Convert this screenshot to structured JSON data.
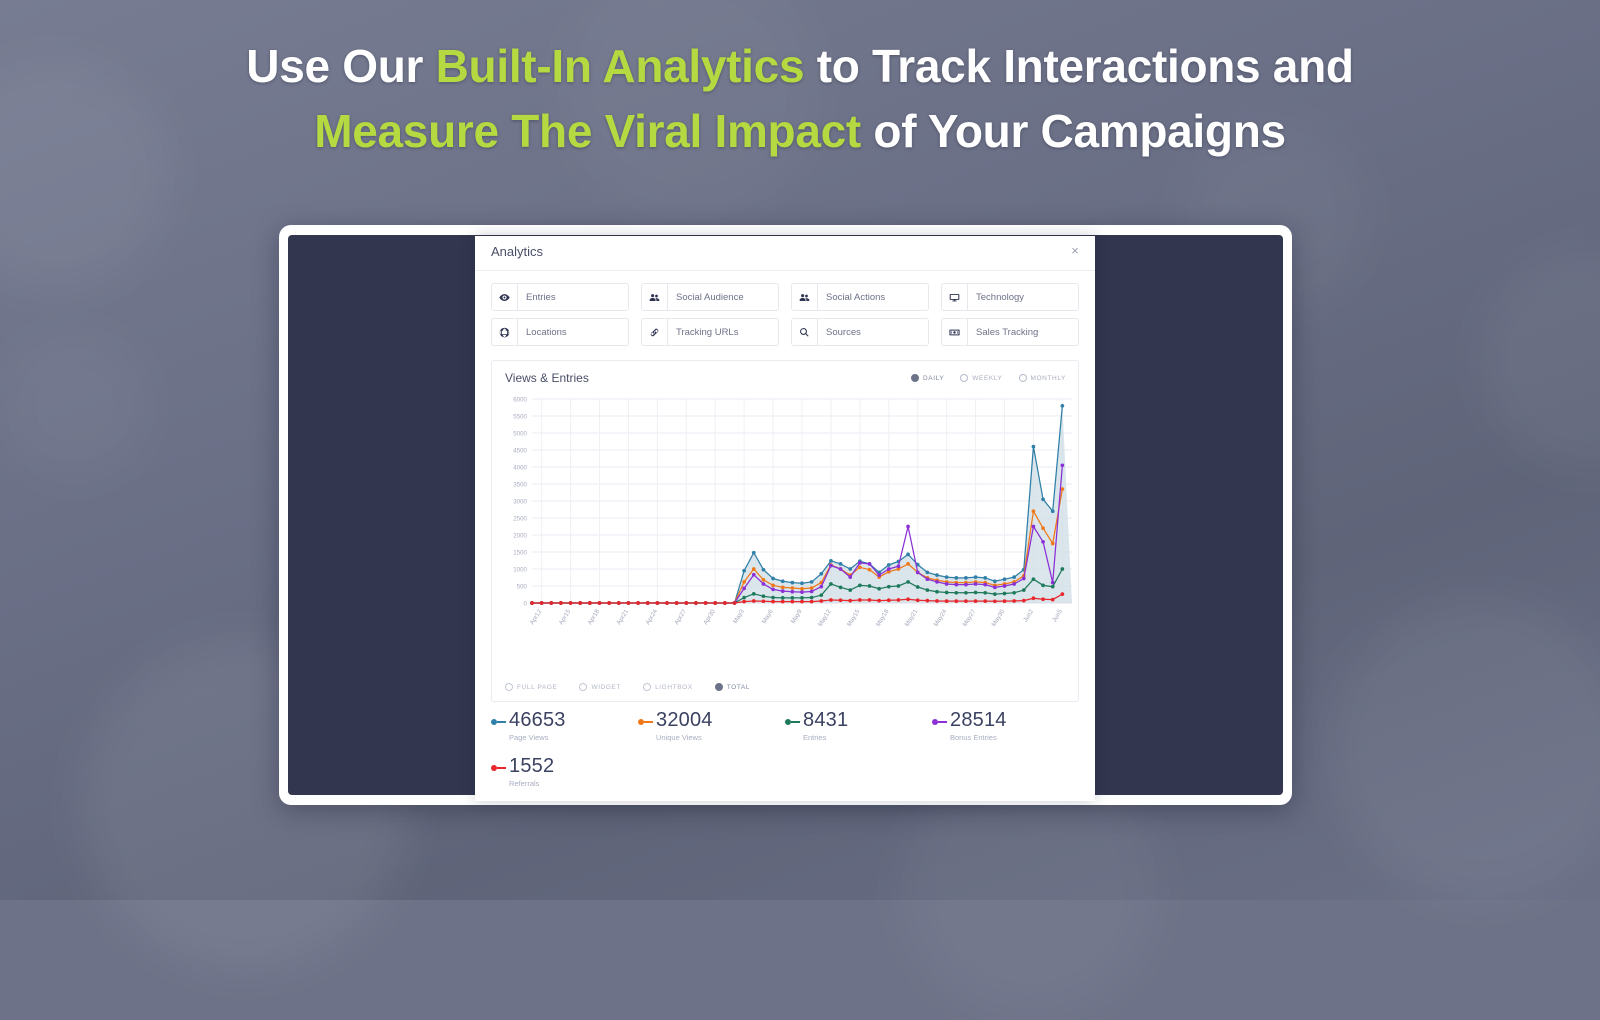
{
  "headline": {
    "line1_a": "Use Our ",
    "line1_hl": "Built-In Analytics",
    "line1_b": " to Track Interactions and",
    "line2_hl": "Measure The Viral Impact",
    "line2_b": " of Your Campaigns",
    "highlight_color": "#b5d940"
  },
  "modal": {
    "title": "Analytics",
    "close_label": "×"
  },
  "nav_buttons": [
    {
      "label": "Entries",
      "icon": "eye-icon"
    },
    {
      "label": "Social Audience",
      "icon": "people-icon"
    },
    {
      "label": "Social Actions",
      "icon": "people-icon"
    },
    {
      "label": "Technology",
      "icon": "monitor-icon"
    },
    {
      "label": "Locations",
      "icon": "globe-icon"
    },
    {
      "label": "Tracking URLs",
      "icon": "link-icon"
    },
    {
      "label": "Sources",
      "icon": "search-icon"
    },
    {
      "label": "Sales Tracking",
      "icon": "money-icon"
    }
  ],
  "chart_card": {
    "title": "Views & Entries",
    "granularity": [
      {
        "label": "DAILY",
        "selected": true
      },
      {
        "label": "WEEKLY",
        "selected": false
      },
      {
        "label": "MONTHLY",
        "selected": false
      }
    ],
    "view_types": [
      {
        "label": "FULL PAGE",
        "selected": false
      },
      {
        "label": "WIDGET",
        "selected": false
      },
      {
        "label": "LIGHTBOX",
        "selected": false
      },
      {
        "label": "TOTAL",
        "selected": true
      }
    ]
  },
  "stats": [
    {
      "value": "46653",
      "label": "Page Views",
      "color": "#2f7fa8"
    },
    {
      "value": "32004",
      "label": "Unique Views",
      "color": "#f07818"
    },
    {
      "value": "8431",
      "label": "Entries",
      "color": "#1f7a5c"
    },
    {
      "value": "28514",
      "label": "Bonus Entries",
      "color": "#8b2fd6"
    },
    {
      "value": "1552",
      "label": "Referrals",
      "color": "#e8262b"
    }
  ],
  "chart_data": {
    "type": "line",
    "title": "Views & Entries",
    "xlabel": "",
    "ylabel": "",
    "ylim": [
      0,
      6000
    ],
    "ytick_step": 500,
    "yticks": [
      0,
      500,
      1000,
      1500,
      2000,
      2500,
      3000,
      3500,
      4000,
      4500,
      5000,
      5500,
      6000
    ],
    "grid": true,
    "legend_position": "bottom",
    "area_fill": true,
    "x": [
      "Apr11",
      "Apr12",
      "Apr13",
      "Apr14",
      "Apr15",
      "Apr16",
      "Apr17",
      "Apr18",
      "Apr19",
      "Apr20",
      "Apr21",
      "Apr22",
      "Apr23",
      "Apr24",
      "Apr25",
      "Apr26",
      "Apr27",
      "Apr28",
      "Apr29",
      "Apr30",
      "May1",
      "May2",
      "May3",
      "May4",
      "May5",
      "May6",
      "May7",
      "May8",
      "May9",
      "May10",
      "May11",
      "May12",
      "May13",
      "May14",
      "May15",
      "May16",
      "May17",
      "May18",
      "May19",
      "May20",
      "May21",
      "May22",
      "May23",
      "May24",
      "May25",
      "May26",
      "May27",
      "May28",
      "May29",
      "May30",
      "May31",
      "Jun1",
      "Jun2",
      "Jun3",
      "Jun4",
      "Jun5",
      "Jun6"
    ],
    "xtick_labels": [
      "Apr12",
      "Apr15",
      "Apr18",
      "Apr21",
      "Apr24",
      "Apr27",
      "Apr30",
      "May3",
      "May6",
      "May9",
      "May12",
      "May15",
      "May18",
      "May21",
      "May24",
      "May27",
      "May30",
      "Jun2",
      "Jun5"
    ],
    "xtick_indices": [
      1,
      4,
      7,
      10,
      13,
      16,
      19,
      22,
      25,
      28,
      31,
      34,
      37,
      40,
      43,
      46,
      49,
      52,
      55
    ],
    "series": [
      {
        "name": "Page Views",
        "color": "#2f7fa8",
        "total": 46653,
        "values": [
          0,
          0,
          0,
          0,
          0,
          0,
          0,
          0,
          0,
          0,
          0,
          0,
          0,
          0,
          0,
          0,
          0,
          0,
          0,
          0,
          0,
          0,
          950,
          1480,
          980,
          720,
          640,
          600,
          580,
          620,
          860,
          1240,
          1150,
          1000,
          1230,
          1150,
          900,
          1120,
          1220,
          1430,
          1130,
          900,
          820,
          760,
          740,
          740,
          760,
          740,
          640,
          700,
          760,
          980,
          4600,
          3050,
          2700,
          5800
        ]
      },
      {
        "name": "Unique Views",
        "color": "#f07818",
        "total": 32004,
        "values": [
          0,
          0,
          0,
          0,
          0,
          0,
          0,
          0,
          0,
          0,
          0,
          0,
          0,
          0,
          0,
          0,
          0,
          0,
          0,
          0,
          0,
          0,
          620,
          1000,
          680,
          520,
          460,
          440,
          420,
          440,
          600,
          1120,
          1000,
          820,
          1050,
          980,
          760,
          920,
          1000,
          1150,
          900,
          740,
          670,
          620,
          600,
          600,
          620,
          600,
          520,
          560,
          620,
          800,
          2700,
          2200,
          1750,
          3350
        ]
      },
      {
        "name": "Entries",
        "color": "#1f7a5c",
        "total": 8431,
        "values": [
          0,
          0,
          0,
          0,
          0,
          0,
          0,
          0,
          0,
          0,
          0,
          0,
          0,
          0,
          0,
          0,
          0,
          0,
          0,
          0,
          0,
          0,
          160,
          270,
          200,
          160,
          150,
          150,
          150,
          160,
          230,
          560,
          460,
          380,
          520,
          500,
          420,
          480,
          500,
          620,
          470,
          380,
          330,
          310,
          300,
          300,
          310,
          300,
          260,
          280,
          300,
          380,
          700,
          520,
          480,
          1000
        ]
      },
      {
        "name": "Bonus Entries",
        "color": "#8b2fd6",
        "total": 28514,
        "values": [
          0,
          0,
          0,
          0,
          0,
          0,
          0,
          0,
          0,
          0,
          0,
          0,
          0,
          0,
          0,
          0,
          0,
          0,
          0,
          0,
          0,
          0,
          430,
          830,
          560,
          400,
          350,
          330,
          320,
          340,
          480,
          1100,
          1000,
          760,
          1180,
          1150,
          820,
          1000,
          1080,
          2250,
          900,
          700,
          620,
          560,
          540,
          540,
          560,
          540,
          460,
          500,
          560,
          720,
          2250,
          1800,
          600,
          4050
        ]
      },
      {
        "name": "Referrals",
        "color": "#e8262b",
        "total": 1552,
        "values": [
          0,
          0,
          0,
          0,
          0,
          0,
          0,
          0,
          0,
          0,
          0,
          0,
          0,
          0,
          0,
          0,
          0,
          0,
          0,
          0,
          0,
          0,
          40,
          60,
          50,
          40,
          40,
          40,
          40,
          40,
          60,
          90,
          80,
          70,
          90,
          90,
          70,
          80,
          90,
          110,
          80,
          70,
          60,
          55,
          55,
          55,
          55,
          55,
          50,
          55,
          60,
          70,
          140,
          110,
          100,
          260
        ]
      }
    ]
  }
}
